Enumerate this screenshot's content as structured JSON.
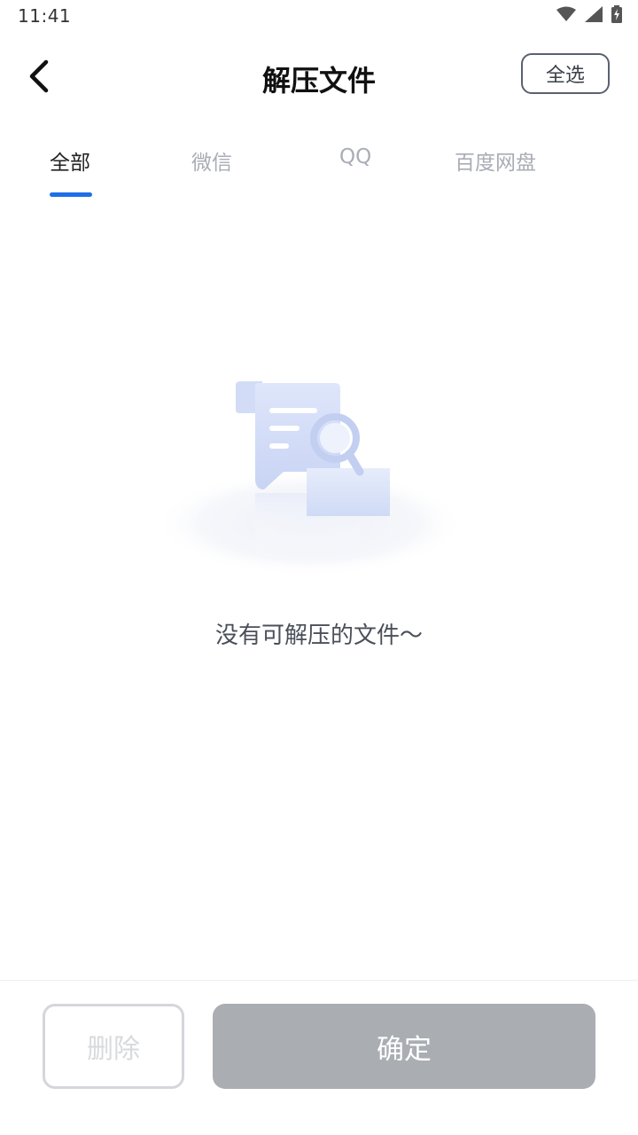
{
  "status_bar": {
    "time": "11:41",
    "icons": [
      "wifi-icon",
      "cellular-signal-icon",
      "battery-charging-icon"
    ]
  },
  "header": {
    "title": "解压文件",
    "back_icon": "chevron-left-icon",
    "select_all_label": "全选"
  },
  "tabs": [
    {
      "label": "全部",
      "active": true
    },
    {
      "label": "微信",
      "active": false
    },
    {
      "label": "QQ",
      "active": false
    },
    {
      "label": "百度网盘",
      "active": false
    }
  ],
  "empty_state": {
    "illustration": "document-search-icon",
    "message": "没有可解压的文件～"
  },
  "bottom_bar": {
    "delete_label": "删除",
    "confirm_label": "确定"
  },
  "colors": {
    "accent": "#1f6fe8",
    "inactive_tab": "#a9adb4",
    "disabled_button": "#aaadb2"
  }
}
